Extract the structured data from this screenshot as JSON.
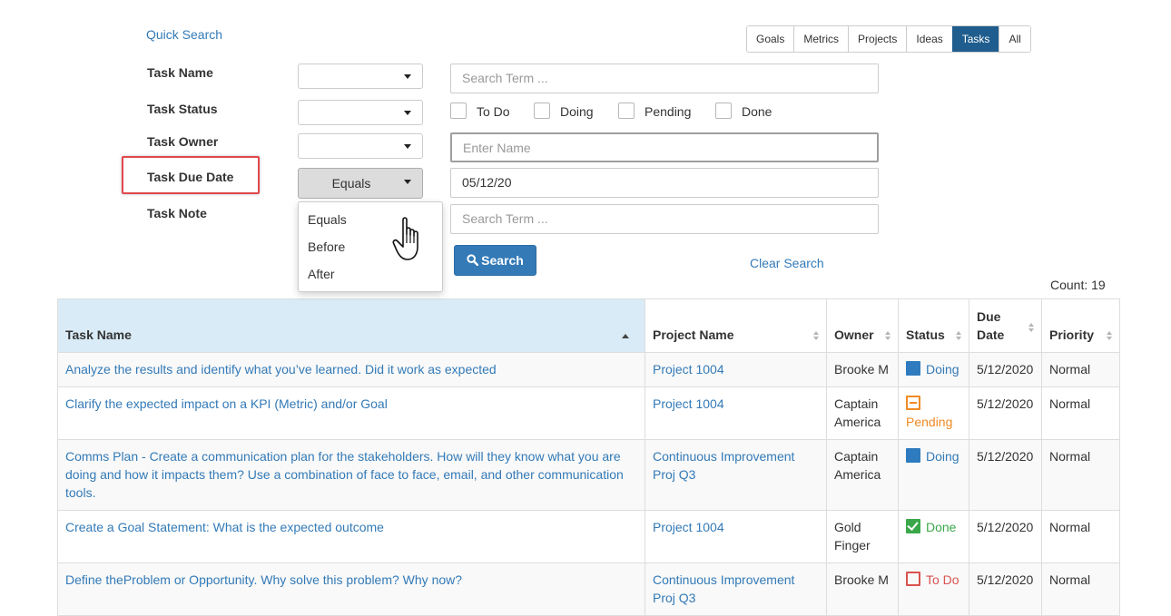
{
  "quick_search": "Quick Search",
  "tabs": [
    {
      "label": "Goals",
      "active": false
    },
    {
      "label": "Metrics",
      "active": false
    },
    {
      "label": "Projects",
      "active": false
    },
    {
      "label": "Ideas",
      "active": false
    },
    {
      "label": "Tasks",
      "active": true
    },
    {
      "label": "All",
      "active": false
    }
  ],
  "form": {
    "task_name_label": "Task Name",
    "task_status_label": "Task Status",
    "task_owner_label": "Task Owner",
    "task_due_date_label": "Task Due Date",
    "task_note_label": "Task Note",
    "search_term_placeholder": "Search Term ...",
    "owner_placeholder": "Enter Name",
    "due_date_operator": "Equals",
    "due_date_value": "05/12/20",
    "note_placeholder": "Search Term ...",
    "status_options": [
      "To Do",
      "Doing",
      "Pending",
      "Done"
    ]
  },
  "dropdown": {
    "options": [
      "Equals",
      "Before",
      "After"
    ]
  },
  "search_button": "Search",
  "clear_search": "Clear Search",
  "count": "Count: 19",
  "table": {
    "headers": {
      "task_name": "Task Name",
      "project_name": "Project Name",
      "owner": "Owner",
      "status": "Status",
      "due_date_line1": "Due",
      "due_date_line2": "Date",
      "priority": "Priority"
    },
    "rows": [
      {
        "task": "Analyze the results and identify what you’ve learned. Did it work as expected",
        "project": "Project 1004",
        "owner": "Brooke M",
        "status": "Doing",
        "due": "5/12/2020",
        "priority": "Normal"
      },
      {
        "task": "Clarify the expected impact on a KPI (Metric) and/or Goal",
        "project": "Project 1004",
        "owner": "Captain America",
        "status": "Pending",
        "due": "5/12/2020",
        "priority": "Normal"
      },
      {
        "task": "Comms Plan - Create a communication plan for the stakeholders. How will they know what you are doing and how it impacts them? Use a combination of face to face, email, and other communication tools.",
        "project": "Continuous Improvement Proj Q3",
        "owner": "Captain America",
        "status": "Doing",
        "due": "5/12/2020",
        "priority": "Normal"
      },
      {
        "task": "Create a Goal Statement: What is the expected outcome",
        "project": "Project 1004",
        "owner": "Gold Finger",
        "status": "Done",
        "due": "5/12/2020",
        "priority": "Normal"
      },
      {
        "task": "Define theProblem or Opportunity. Why solve this problem? Why now?",
        "project": "Continuous Improvement Proj Q3",
        "owner": "Brooke M",
        "status": "To Do",
        "due": "5/12/2020",
        "priority": "Normal"
      }
    ]
  },
  "colors": {
    "primary": "#337ab7",
    "tab_active": "#1f5d8e",
    "highlight": "#e0484c",
    "doing": "#2f7bbf",
    "done": "#3aa84a",
    "todo": "#d9534f",
    "pending": "#f08a24"
  }
}
